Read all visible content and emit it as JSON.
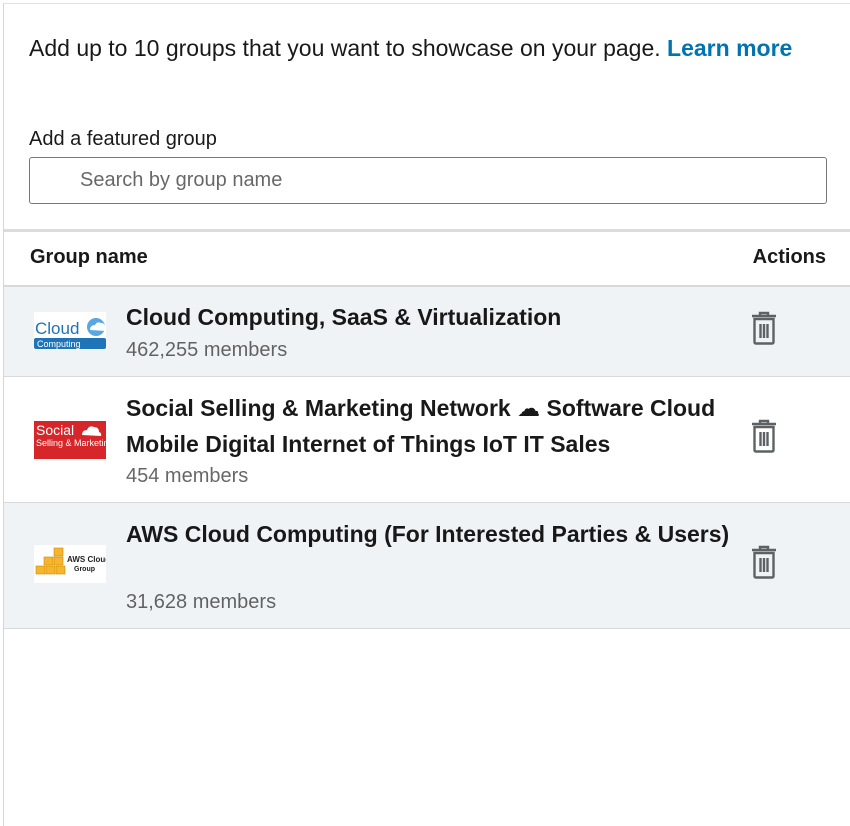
{
  "intro": {
    "text": "Add up to 10 groups that you want to showcase on your page.",
    "link_label": "Learn more"
  },
  "search": {
    "label": "Add a featured group",
    "placeholder": "Search by group name",
    "value": ""
  },
  "table": {
    "columns": [
      "Group name",
      "Actions"
    ],
    "rows": [
      {
        "name": "Cloud Computing, SaaS & Virtualization",
        "members": "462,255 members",
        "logo": {
          "icon": "cloud-computing-logo",
          "text": "Cloud",
          "subtext": "Computing"
        }
      },
      {
        "name": "Social Selling & Marketing Network ☁  Software Cloud Mobile Digital Internet of Things IoT IT Sales",
        "members": "454 members",
        "logo": {
          "icon": "social-selling-logo",
          "text": "Social",
          "subtext": "Selling & Marketing"
        }
      },
      {
        "name": "AWS Cloud Computing (For Interested Parties & Users)",
        "members": "31,628 members",
        "logo": {
          "icon": "aws-cloud-group-logo",
          "text": "AWS Cloud",
          "subtext": "Group"
        }
      }
    ],
    "delete_icon": "trash-icon"
  },
  "colors": {
    "link": "#0073b1",
    "row_shade": "#f0f3f6",
    "social_red": "#d7262a",
    "cloud_blue": "#1f73b7",
    "aws_yellow": "#f7b52b"
  }
}
